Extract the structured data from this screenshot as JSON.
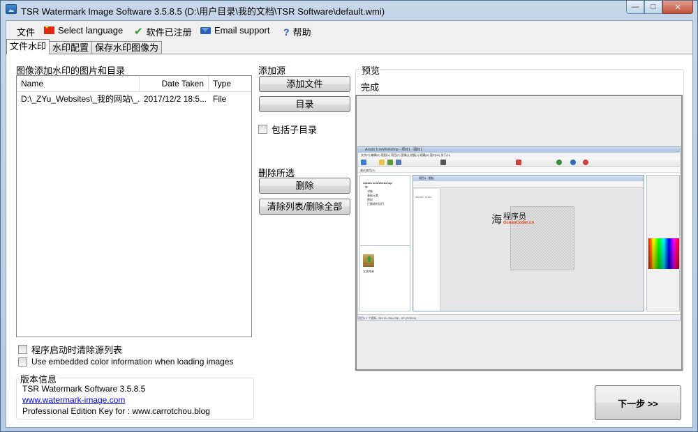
{
  "window": {
    "title": "TSR Watermark Image Software 3.5.8.5 (D:\\用户目录\\我的文档\\TSR Software\\default.wmi)",
    "controls": {
      "minimize": "—",
      "maximize": "□",
      "close": "✕"
    }
  },
  "menu": {
    "file": "文件",
    "language": "Select language",
    "registered": "软件已注册",
    "email": "Email support",
    "help": "帮助"
  },
  "tabs": [
    "文件水印",
    "水印配置",
    "保存水印图像为"
  ],
  "sources": {
    "label": "图像添加水印的图片和目录",
    "columns": [
      "Name",
      "Date Taken",
      "Type"
    ],
    "rows": [
      {
        "name": "D:\\_ZYu_Websites\\_我的网站\\_...",
        "date_taken": "2017/12/2 18:5...",
        "type": "File"
      }
    ]
  },
  "add_source": {
    "label": "添加源",
    "add_file": "添加文件",
    "directory": "目录",
    "include_subdirs": "包括子目录"
  },
  "delete_selected": {
    "label": "删除所选",
    "delete": "删除",
    "clear_all": "清除列表/删除全部"
  },
  "options": {
    "clear_on_start": "程序启动时清除源列表",
    "embedded_color": "Use embedded color information when loading images"
  },
  "version": {
    "label": "版本信息",
    "line1": "TSR Watermark Software 3.5.8.5",
    "link": "www.watermark-image.com",
    "line3": "Professional Edition Key for : www.carrotchou.blog"
  },
  "preview": {
    "label": "预览",
    "status": "完成",
    "watermark": {
      "char": "海",
      "name": "程序员",
      "site": "OceanCoder.cn"
    },
    "shot": {
      "title": "Axialis IconWorkshop - 项目1 - 图标1",
      "menu": "文件(F)  编辑(E)  视图(V)  项目(P)  图像(I)  滤镜(L)  收藏(A)  窗口(W)  关于(H)",
      "address": "最近使用(R)",
      "tree": [
        "Axialis IconWorkshop",
        "库",
        "对象",
        "基础元素",
        "图标",
        "已删除的项目"
      ],
      "folder_label": "父文件夹",
      "main_title": "项目1 - 图标",
      "size_label": "256x256 - RGB/A",
      "status": "项目1          1 个图标, 256 Kb        256x256 - XP (RGB/A)"
    }
  },
  "next_button": "下一步 >>"
}
